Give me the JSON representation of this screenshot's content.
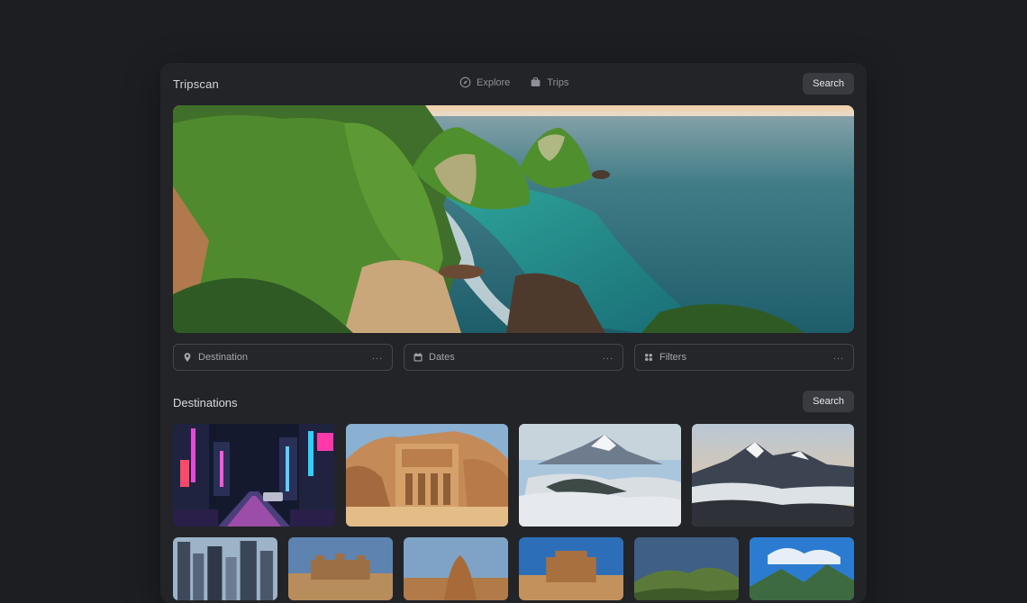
{
  "header": {
    "brand": "Tripscan",
    "nav": [
      {
        "label": "Explore",
        "icon": "compass-icon"
      },
      {
        "label": "Trips",
        "icon": "suitcase-icon"
      }
    ],
    "search_label": "Search"
  },
  "hero": {
    "image": "coastal-cliffs-ocean-sunset"
  },
  "fields": [
    {
      "label": "Destination",
      "icon": "location-pin-icon",
      "more": "..."
    },
    {
      "label": "Dates",
      "icon": "calendar-icon",
      "more": "..."
    },
    {
      "label": "Filters",
      "icon": "filters-icon",
      "more": "..."
    }
  ],
  "destinations": {
    "title": "Destinations",
    "search_label": "Search",
    "row1": [
      {
        "image": "neon-city-street-night"
      },
      {
        "image": "rock-carved-temple-desert"
      },
      {
        "image": "snowy-mountain-above-clouds"
      },
      {
        "image": "snowy-mountain-range-sunrise"
      }
    ],
    "row2": [
      {
        "image": "city-skyscrapers"
      },
      {
        "image": "desert-ruins"
      },
      {
        "image": "desert-rock-formation"
      },
      {
        "image": "rock-carved-temple-sky"
      },
      {
        "image": "green-mountain-ridge"
      },
      {
        "image": "mountains-blue-sky"
      }
    ]
  },
  "colors": {
    "background": "#1d1e22",
    "panel": "#232428",
    "button": "#3a3b40",
    "field_border": "#45464c"
  }
}
